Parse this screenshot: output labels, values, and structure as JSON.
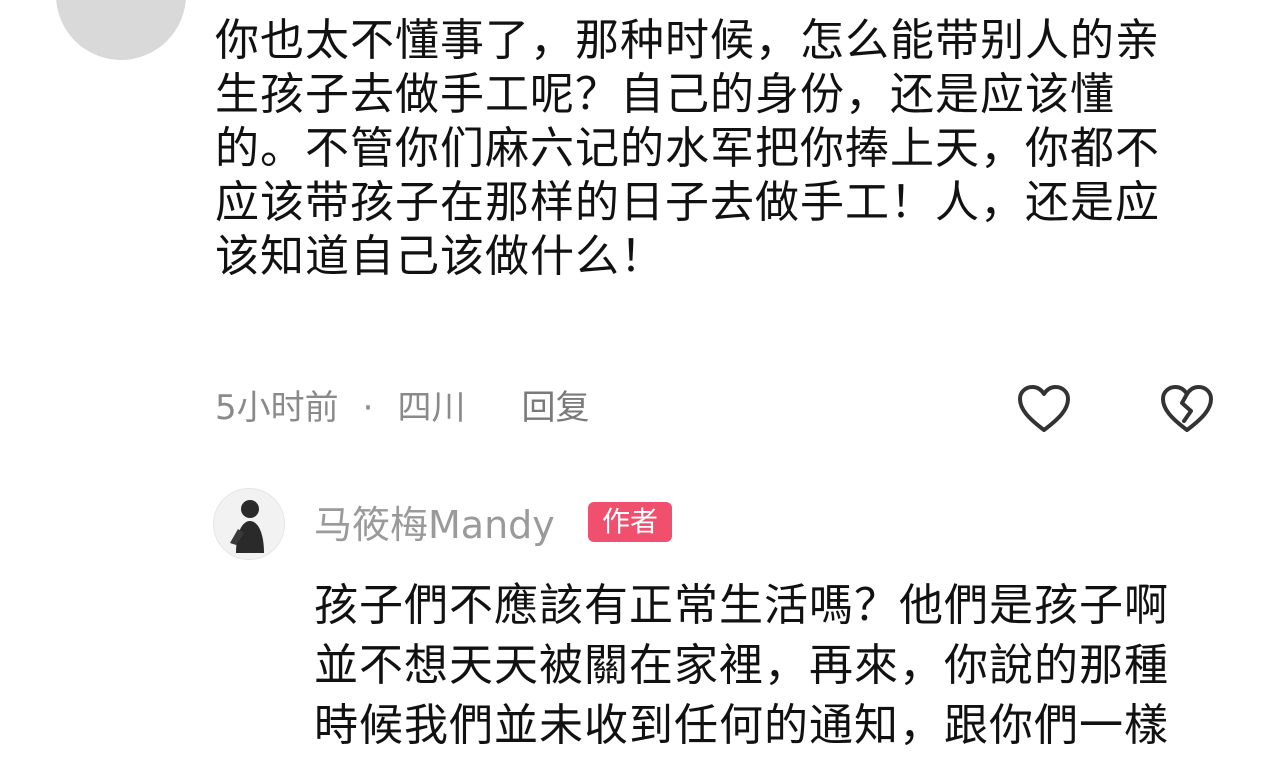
{
  "comment": {
    "lines": [
      "你也太不懂事了，那种时候，怎么能带别人的亲",
      "生孩子去做手工呢？自己的身份，还是应该懂",
      "的。不管你们麻六记的水军把你捧上天，你都不",
      "应该带孩子在那样的日子去做手工！人，还是应",
      "该知道自己该做什么！"
    ],
    "time": "5小时前",
    "separator": "·",
    "location": "四川",
    "reply_label": "回复",
    "like_icon": "heart-outline-icon",
    "dislike_icon": "broken-heart-icon"
  },
  "reply": {
    "username": "马筱梅Mandy",
    "badge": "作者",
    "badge_color": "#f0506e",
    "lines": [
      "孩子們不應該有正常生活嗎？他們是孩子啊",
      "並不想天天被關在家裡，再來，你說的那種",
      "時候我們並未收到任何的通知，跟你們一樣"
    ]
  }
}
